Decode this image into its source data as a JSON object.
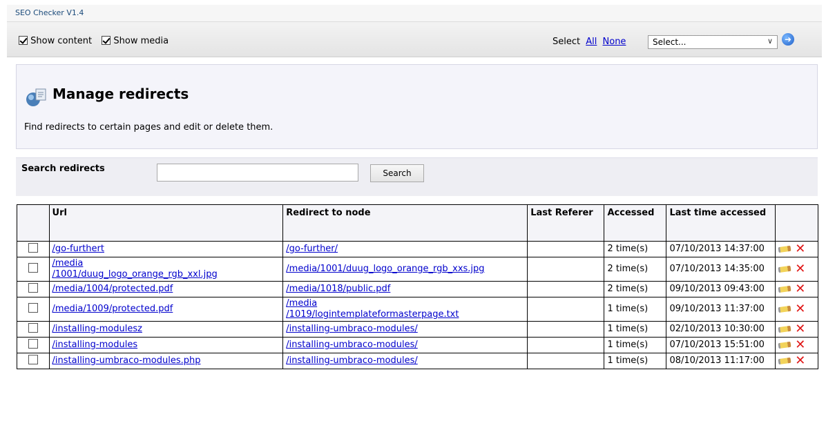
{
  "app": {
    "title": "SEO Checker V1.4"
  },
  "toolbar": {
    "show_content_label": "Show content",
    "show_media_label": "Show media",
    "select_label": "Select",
    "all_link": "All",
    "none_link": "None",
    "select_value": "Select..."
  },
  "header": {
    "title": "Manage redirects",
    "description": "Find redirects to certain pages and edit or delete them."
  },
  "search": {
    "label": "Search redirects",
    "input_value": "",
    "button_label": "Search"
  },
  "table": {
    "headers": {
      "url": "Url",
      "redirect": "Redirect to node",
      "referer": "Last Referer",
      "accessed": "Accessed",
      "last_time": "Last time accessed"
    },
    "rows": [
      {
        "url": "/go-furthert",
        "redirect": "/go-further/",
        "referer": "",
        "accessed": "2 time(s)",
        "last": "07/10/2013 14:37:00"
      },
      {
        "url": "/media\n/1001/duug_logo_orange_rgb_xxl.jpg",
        "redirect": "/media/1001/duug_logo_orange_rgb_xxs.jpg",
        "referer": "",
        "accessed": "2 time(s)",
        "last": "07/10/2013 14:35:00"
      },
      {
        "url": "/media/1004/protected.pdf",
        "redirect": "/media/1018/public.pdf",
        "referer": "",
        "accessed": "2 time(s)",
        "last": "09/10/2013 09:43:00"
      },
      {
        "url": "/media/1009/protected.pdf",
        "redirect": "/media\n/1019/logintemplateformasterpage.txt",
        "referer": "",
        "accessed": "1 time(s)",
        "last": "09/10/2013 11:37:00"
      },
      {
        "url": "/installing-modulesz",
        "redirect": "/installing-umbraco-modules/",
        "referer": "",
        "accessed": "1 time(s)",
        "last": "02/10/2013 10:30:00"
      },
      {
        "url": "/installing-modules",
        "redirect": "/installing-umbraco-modules/",
        "referer": "",
        "accessed": "1 time(s)",
        "last": "07/10/2013 15:51:00"
      },
      {
        "url": "/installing-umbraco-modules.php",
        "redirect": "/installing-umbraco-modules/",
        "referer": "",
        "accessed": "1 time(s)",
        "last": "08/10/2013 11:17:00"
      }
    ]
  }
}
